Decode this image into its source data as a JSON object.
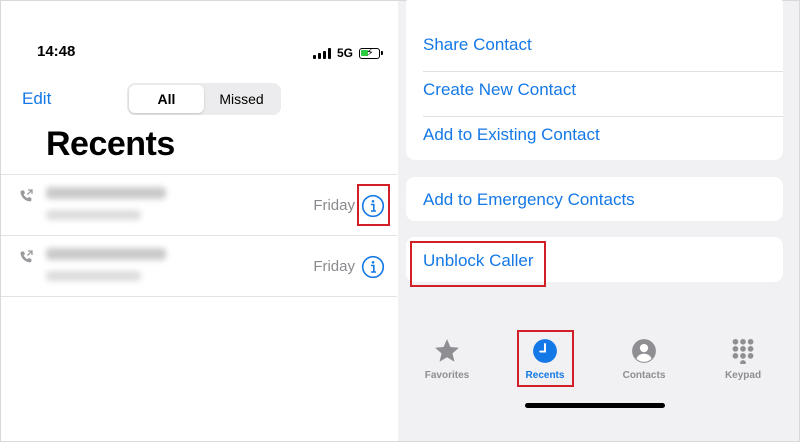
{
  "status_bar": {
    "time": "14:48",
    "network": "5G"
  },
  "header": {
    "edit_label": "Edit",
    "segments": [
      "All",
      "Missed"
    ],
    "active_segment": "All"
  },
  "page_title": "Recents",
  "recents": [
    {
      "day": "Friday",
      "info_icon": "info-icon"
    },
    {
      "day": "Friday",
      "info_icon": "info-icon"
    }
  ],
  "contact_actions": {
    "group1": [
      "Share Contact",
      "Create New Contact",
      "Add to Existing Contact"
    ],
    "emergency": "Add to Emergency Contacts",
    "unblock": "Unblock Caller"
  },
  "tab_bar": {
    "tabs": [
      {
        "label": "Favorites",
        "icon": "star-icon"
      },
      {
        "label": "Recents",
        "icon": "clock-icon"
      },
      {
        "label": "Contacts",
        "icon": "person-icon"
      },
      {
        "label": "Keypad",
        "icon": "keypad-icon"
      }
    ],
    "active": "Recents"
  },
  "colors": {
    "accent": "#1478e6",
    "highlight": "#d21f27",
    "secondary_text": "#8a8a8e"
  }
}
